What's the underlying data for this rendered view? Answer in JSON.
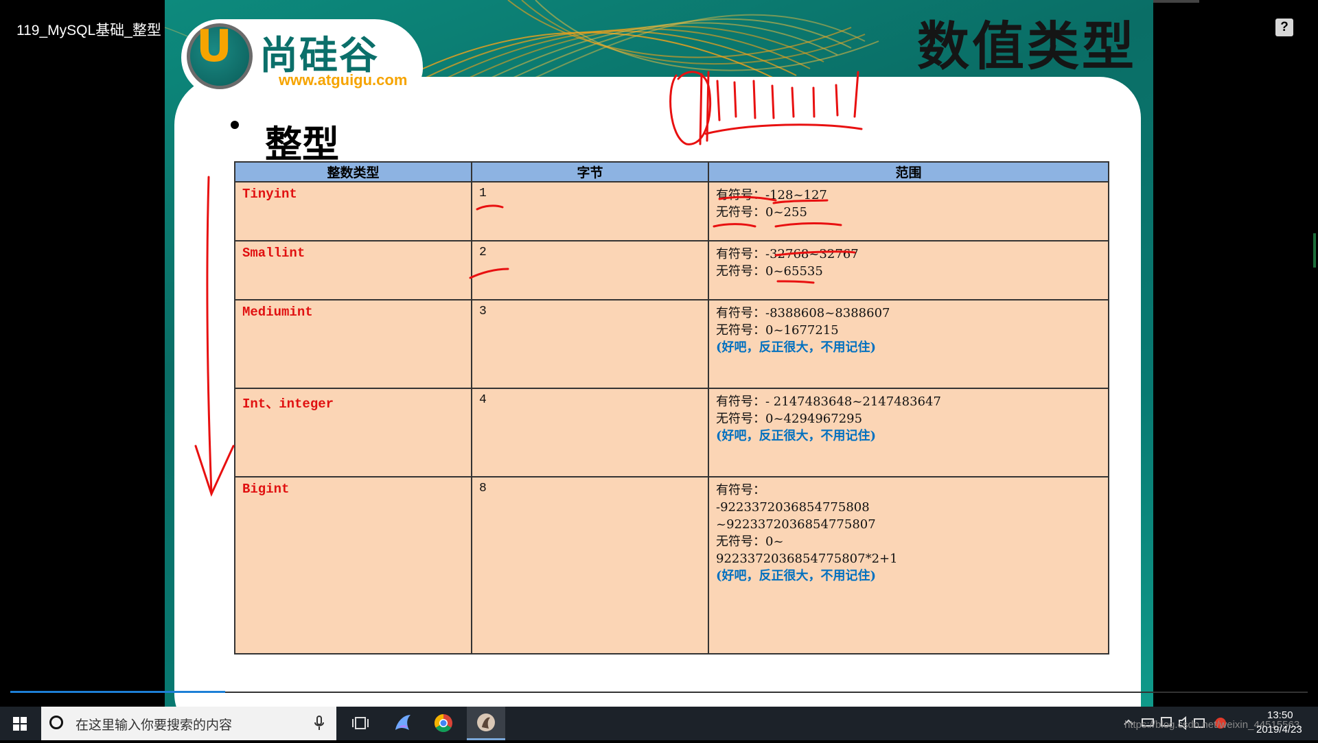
{
  "video": {
    "title": "119_MySQL基础_整型",
    "help_label": "?"
  },
  "slide": {
    "logo_name": "尚硅谷",
    "logo_url": "www.atguigu.com",
    "logo_letter": "U",
    "title": "数值类型",
    "section": "整型"
  },
  "table": {
    "headers": [
      "整数类型",
      "字节",
      "范围"
    ],
    "rows": [
      {
        "type": "Tinyint",
        "bytes": "1",
        "range": [
          "有符号：-128~127",
          "无符号：0~255"
        ],
        "note": ""
      },
      {
        "type": "Smallint",
        "bytes": "2",
        "range": [
          "有符号：-32768~32767",
          "无符号：0~65535"
        ],
        "note": ""
      },
      {
        "type": "Mediumint",
        "bytes": "3",
        "range": [
          "有符号：-8388608~8388607",
          "无符号：0~1677215"
        ],
        "note": "(好吧，反正很大，不用记住)"
      },
      {
        "type": "Int、integer",
        "bytes": "4",
        "range": [
          "有符号：- 2147483648~2147483647",
          "无符号：0~4294967295"
        ],
        "note": "(好吧，反正很大，不用记住)"
      },
      {
        "type": "Bigint",
        "bytes": "8",
        "range": [
          "有符号：",
          "-9223372036854775808",
          "~9223372036854775807",
          "无符号：0~",
          "9223372036854775807*2+1"
        ],
        "note": "(好吧，反正很大，不用记住)"
      }
    ]
  },
  "taskbar": {
    "search_placeholder": "在这里输入你要搜索的内容",
    "tray_url": "https://blog.csdn.net/weixin_44515563",
    "time": "13:50",
    "date": "2019/4/23"
  },
  "colors": {
    "annotation": "#e81010",
    "slide_bg": "#0a6e66",
    "header": "#8db3e2",
    "cell": "#fbd5b5",
    "type_text": "#e01010",
    "note_text": "#0070c0"
  }
}
